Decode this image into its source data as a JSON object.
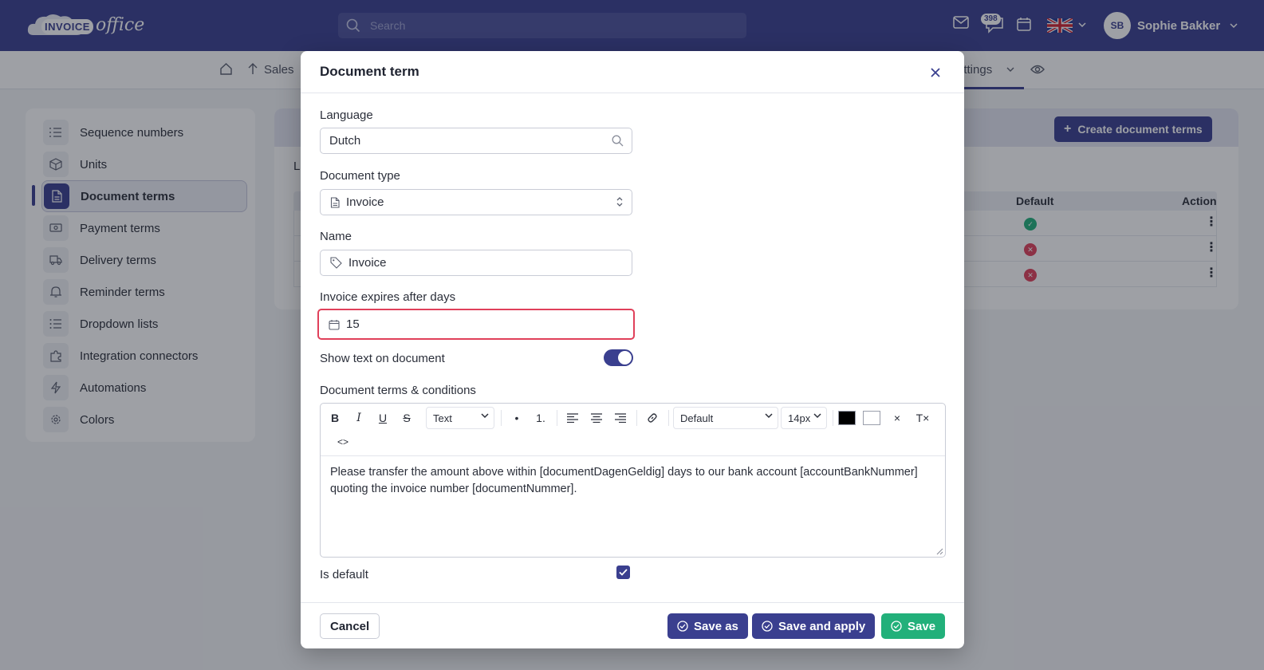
{
  "header": {
    "logo_word": "INVOICE",
    "logo_script": "office",
    "search_placeholder": "Search",
    "notification_count": "398",
    "user_initials": "SB",
    "user_name": "Sophie Bakker"
  },
  "subnav": {
    "sales": "Sales",
    "settings": "ettings"
  },
  "sidebar": {
    "items": [
      {
        "label": "Sequence numbers",
        "icon": "list-numbers-icon"
      },
      {
        "label": "Units",
        "icon": "cube-icon"
      },
      {
        "label": "Document terms",
        "icon": "document-icon"
      },
      {
        "label": "Payment terms",
        "icon": "money-icon"
      },
      {
        "label": "Delivery terms",
        "icon": "truck-icon"
      },
      {
        "label": "Reminder terms",
        "icon": "bell-icon"
      },
      {
        "label": "Dropdown lists",
        "icon": "list-icon"
      },
      {
        "label": "Integration connectors",
        "icon": "puzzle-icon"
      },
      {
        "label": "Automations",
        "icon": "bolt-icon"
      },
      {
        "label": "Colors",
        "icon": "gear-icon"
      }
    ]
  },
  "main": {
    "create_button": "Create document terms",
    "partial_label": "L",
    "columns": {
      "default": "Default",
      "action": "Action"
    },
    "rows": [
      {
        "default": true
      },
      {
        "default": false
      },
      {
        "default": false
      }
    ]
  },
  "modal": {
    "title": "Document term",
    "language_label": "Language",
    "language_value": "Dutch",
    "doctype_label": "Document type",
    "doctype_value": "Invoice",
    "name_label": "Name",
    "name_value": "Invoice",
    "expires_label": "Invoice expires after days",
    "expires_value": "15",
    "show_text_label": "Show text on document",
    "show_text_on": true,
    "terms_label": "Document terms & conditions",
    "toolbar": {
      "bold": "B",
      "italic": "I",
      "underline": "U",
      "strike": "S",
      "block_format": "Text",
      "bullet": "•",
      "numbered": "1.",
      "font": "Default",
      "font_size": "14px",
      "clear": "×",
      "clear_format": "T×",
      "code": "<>"
    },
    "terms_text": "Please transfer the amount above within [documentDagenGeldig] days to our bank account [accountBankNummer] quoting the invoice number [documentNummer].",
    "is_default_label": "Is default",
    "is_default": true,
    "buttons": {
      "cancel": "Cancel",
      "save_as": "Save as",
      "save_apply": "Save and apply",
      "save": "Save"
    }
  },
  "colors": {
    "brand": "#3a3f8f",
    "success": "#22b07a",
    "danger": "#e0405a"
  }
}
